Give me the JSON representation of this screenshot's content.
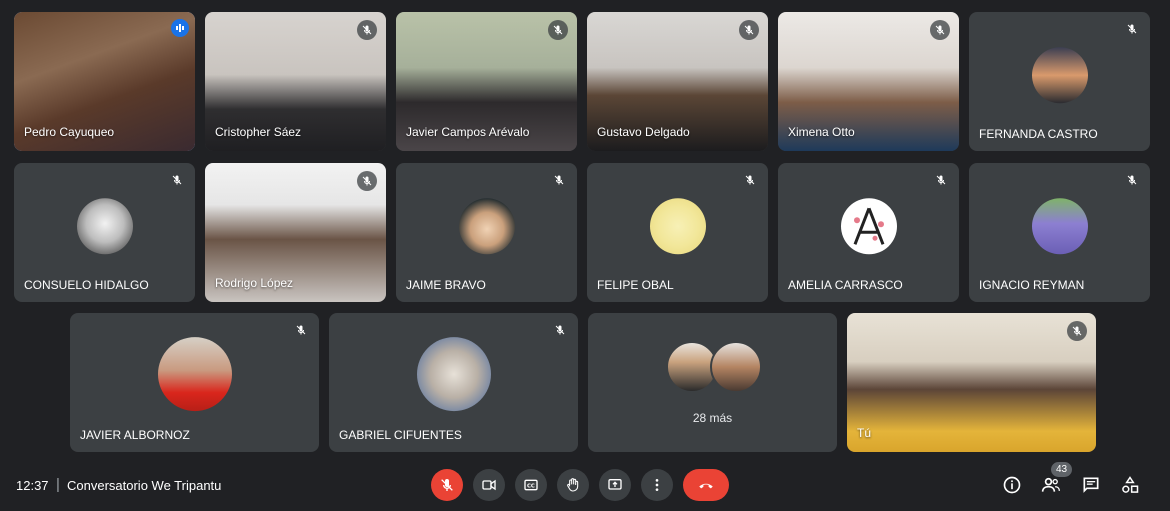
{
  "participants": [
    {
      "name": "Pedro Cayuqueo"
    },
    {
      "name": "Cristopher Sáez"
    },
    {
      "name": "Javier Campos Arévalo"
    },
    {
      "name": "Gustavo Delgado"
    },
    {
      "name": "Ximena Otto"
    },
    {
      "name": "FERNANDA CASTRO"
    },
    {
      "name": "CONSUELO HIDALGO"
    },
    {
      "name": "Rodrigo López"
    },
    {
      "name": "JAIME BRAVO"
    },
    {
      "name": "FELIPE OBAL"
    },
    {
      "name": "AMELIA CARRASCO"
    },
    {
      "name": "IGNACIO REYMAN"
    },
    {
      "name": "JAVIER ALBORNOZ"
    },
    {
      "name": "GABRIEL CIFUENTES"
    },
    {
      "name": "Tú"
    }
  ],
  "more_tile": {
    "label": "28 más"
  },
  "bottom_bar": {
    "time": "12:37",
    "separator": "|",
    "meeting_title": "Conversatorio We Tripantu",
    "participants_count": "43"
  },
  "colors": {
    "background": "#202124",
    "tile": "#3c4043",
    "speaking_border": "#8ab4f8",
    "end_call": "#ea4335",
    "mic_off": "#ea4335"
  },
  "icons": [
    "microphone-off-icon",
    "camera-icon",
    "captions-icon",
    "raise-hand-icon",
    "present-screen-icon",
    "more-options-icon",
    "end-call-icon",
    "info-icon",
    "people-icon",
    "chat-icon",
    "activities-icon"
  ]
}
